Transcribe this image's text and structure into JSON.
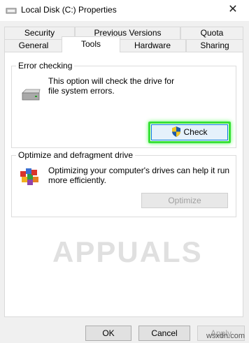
{
  "window": {
    "title": "Local Disk (C:) Properties",
    "close_glyph": "✕"
  },
  "tabs": {
    "row1": [
      "Security",
      "Previous Versions",
      "Quota"
    ],
    "row2": [
      "General",
      "Tools",
      "Hardware",
      "Sharing"
    ],
    "active": "Tools"
  },
  "error_checking": {
    "label": "Error checking",
    "description": "This option will check the drive for file system errors.",
    "check_button": "Check"
  },
  "optimize": {
    "label": "Optimize and defragment drive",
    "description": "Optimizing your computer's drives can help it run more efficiently.",
    "optimize_button": "Optimize"
  },
  "footer": {
    "ok": "OK",
    "cancel": "Cancel",
    "apply": "Apply"
  },
  "watermarks": {
    "appuals": "APPUALS",
    "site": "wsxdn.com"
  },
  "colors": {
    "highlight": "#38e038",
    "accent": "#1e5aa8"
  }
}
